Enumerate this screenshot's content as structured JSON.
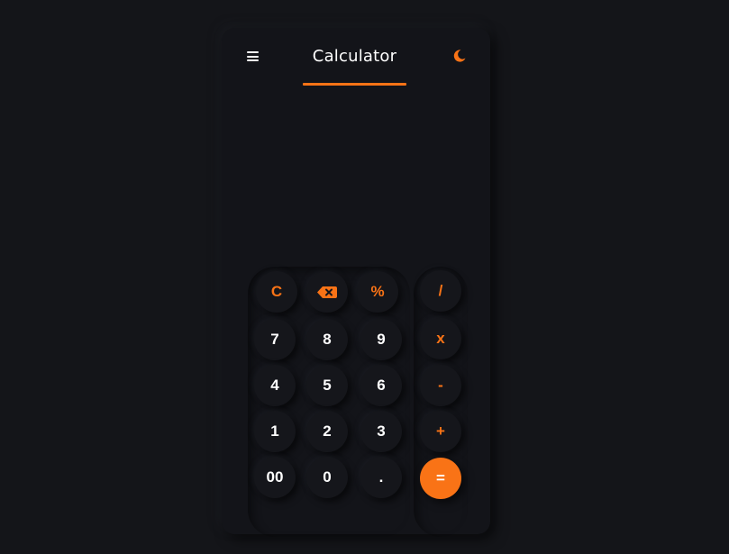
{
  "header": {
    "menu_icon": "menu-icon",
    "title": "Calculator",
    "theme_icon": "moon-icon"
  },
  "display": {
    "expression": "",
    "result": ""
  },
  "keypad": {
    "rows": [
      [
        "C",
        "backspace",
        "%"
      ],
      [
        "7",
        "8",
        "9"
      ],
      [
        "4",
        "5",
        "6"
      ],
      [
        "1",
        "2",
        "3"
      ],
      [
        "00",
        "0",
        "."
      ]
    ],
    "clear_label": "C",
    "percent_label": "%",
    "seven": "7",
    "eight": "8",
    "nine": "9",
    "four": "4",
    "five": "5",
    "six": "6",
    "one": "1",
    "two": "2",
    "three": "3",
    "double_zero": "00",
    "zero": "0",
    "decimal": "."
  },
  "operators": {
    "divide": "/",
    "multiply": "x",
    "subtract": "-",
    "add": "+",
    "equals": "="
  },
  "colors": {
    "accent": "#f97316",
    "background": "#141519",
    "text": "#ffffff"
  }
}
